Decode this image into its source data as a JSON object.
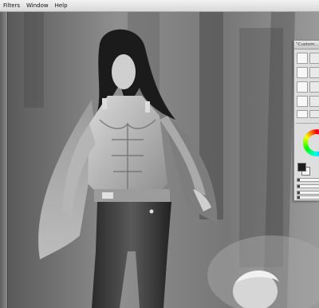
{
  "menu": {
    "items": [
      "Filters",
      "Window",
      "Help"
    ]
  },
  "panel": {
    "title": "\"Custom...\"",
    "brush_count": 6,
    "slider_count": 4
  },
  "colors": {
    "foreground": "#1e1e1e",
    "background": "#f4f4f4"
  },
  "icons": [
    "brush-preset-icon",
    "color-wheel-icon",
    "foreground-color-swatch",
    "background-color-swatch"
  ]
}
